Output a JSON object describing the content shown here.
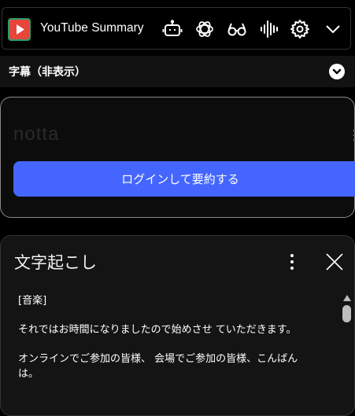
{
  "header": {
    "title": "YouTube Summary",
    "icons": [
      "youtube-summary-logo",
      "bot-icon",
      "openai-icon",
      "glasses-icon",
      "waveform-icon",
      "gear-icon",
      "chevron-down-icon"
    ],
    "accent": "#e8453c"
  },
  "subtitle_bar": {
    "label": "字幕（非表示）"
  },
  "notta": {
    "brand": "notta",
    "login_label": "ログインして要約する",
    "button_color": "#4466ff"
  },
  "transcript": {
    "title": "文字起こし",
    "lines": [
      "[音楽]",
      "それではお時間になりましたので始めさせ ていただきます。",
      "オンラインでご参加の皆様、 会場でご参加の皆様、こんばんは。"
    ]
  }
}
